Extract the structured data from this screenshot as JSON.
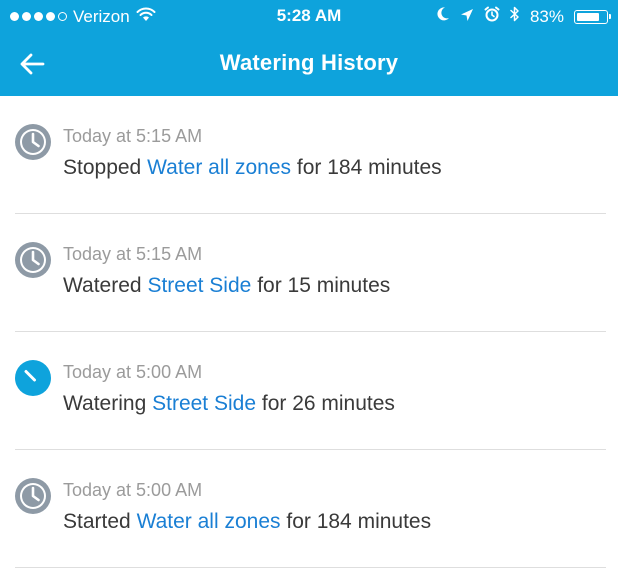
{
  "status_bar": {
    "carrier": "Verizon",
    "time": "5:28 AM",
    "battery_percent": "83%",
    "battery_level": 0.83,
    "signal_bars_filled": 4,
    "signal_bars_total": 5,
    "icons": [
      "wifi-icon",
      "moon-icon",
      "location-arrow-icon",
      "alarm-icon",
      "bluetooth-icon",
      "battery-icon"
    ]
  },
  "header": {
    "title": "Watering History",
    "back_icon": "back-arrow-icon",
    "background_color": "#0ea3dc"
  },
  "history": [
    {
      "time": "Today at 5:15 AM",
      "verb": "Stopped",
      "zone": "Water all zones",
      "duration": "for 184 minutes",
      "status": "completed",
      "icon": "clock-icon",
      "icon_color": "#8e9aa6"
    },
    {
      "time": "Today at 5:15 AM",
      "verb": "Watered",
      "zone": "Street Side",
      "duration": "for 15 minutes",
      "status": "completed",
      "icon": "clock-icon",
      "icon_color": "#8e9aa6"
    },
    {
      "time": "Today at 5:00 AM",
      "verb": "Watering",
      "zone": "Street Side",
      "duration": "for 26 minutes",
      "status": "in-progress",
      "icon": "timer-icon",
      "icon_color": "#0ea3dc"
    },
    {
      "time": "Today at 5:00 AM",
      "verb": "Started",
      "zone": "Water all zones",
      "duration": "for 184 minutes",
      "status": "completed",
      "icon": "clock-icon",
      "icon_color": "#8e9aa6"
    }
  ],
  "colors": {
    "link": "#1a7fd4",
    "timestamp": "#9b9b9b",
    "text": "#3a3a3a",
    "divider": "#dedede"
  }
}
